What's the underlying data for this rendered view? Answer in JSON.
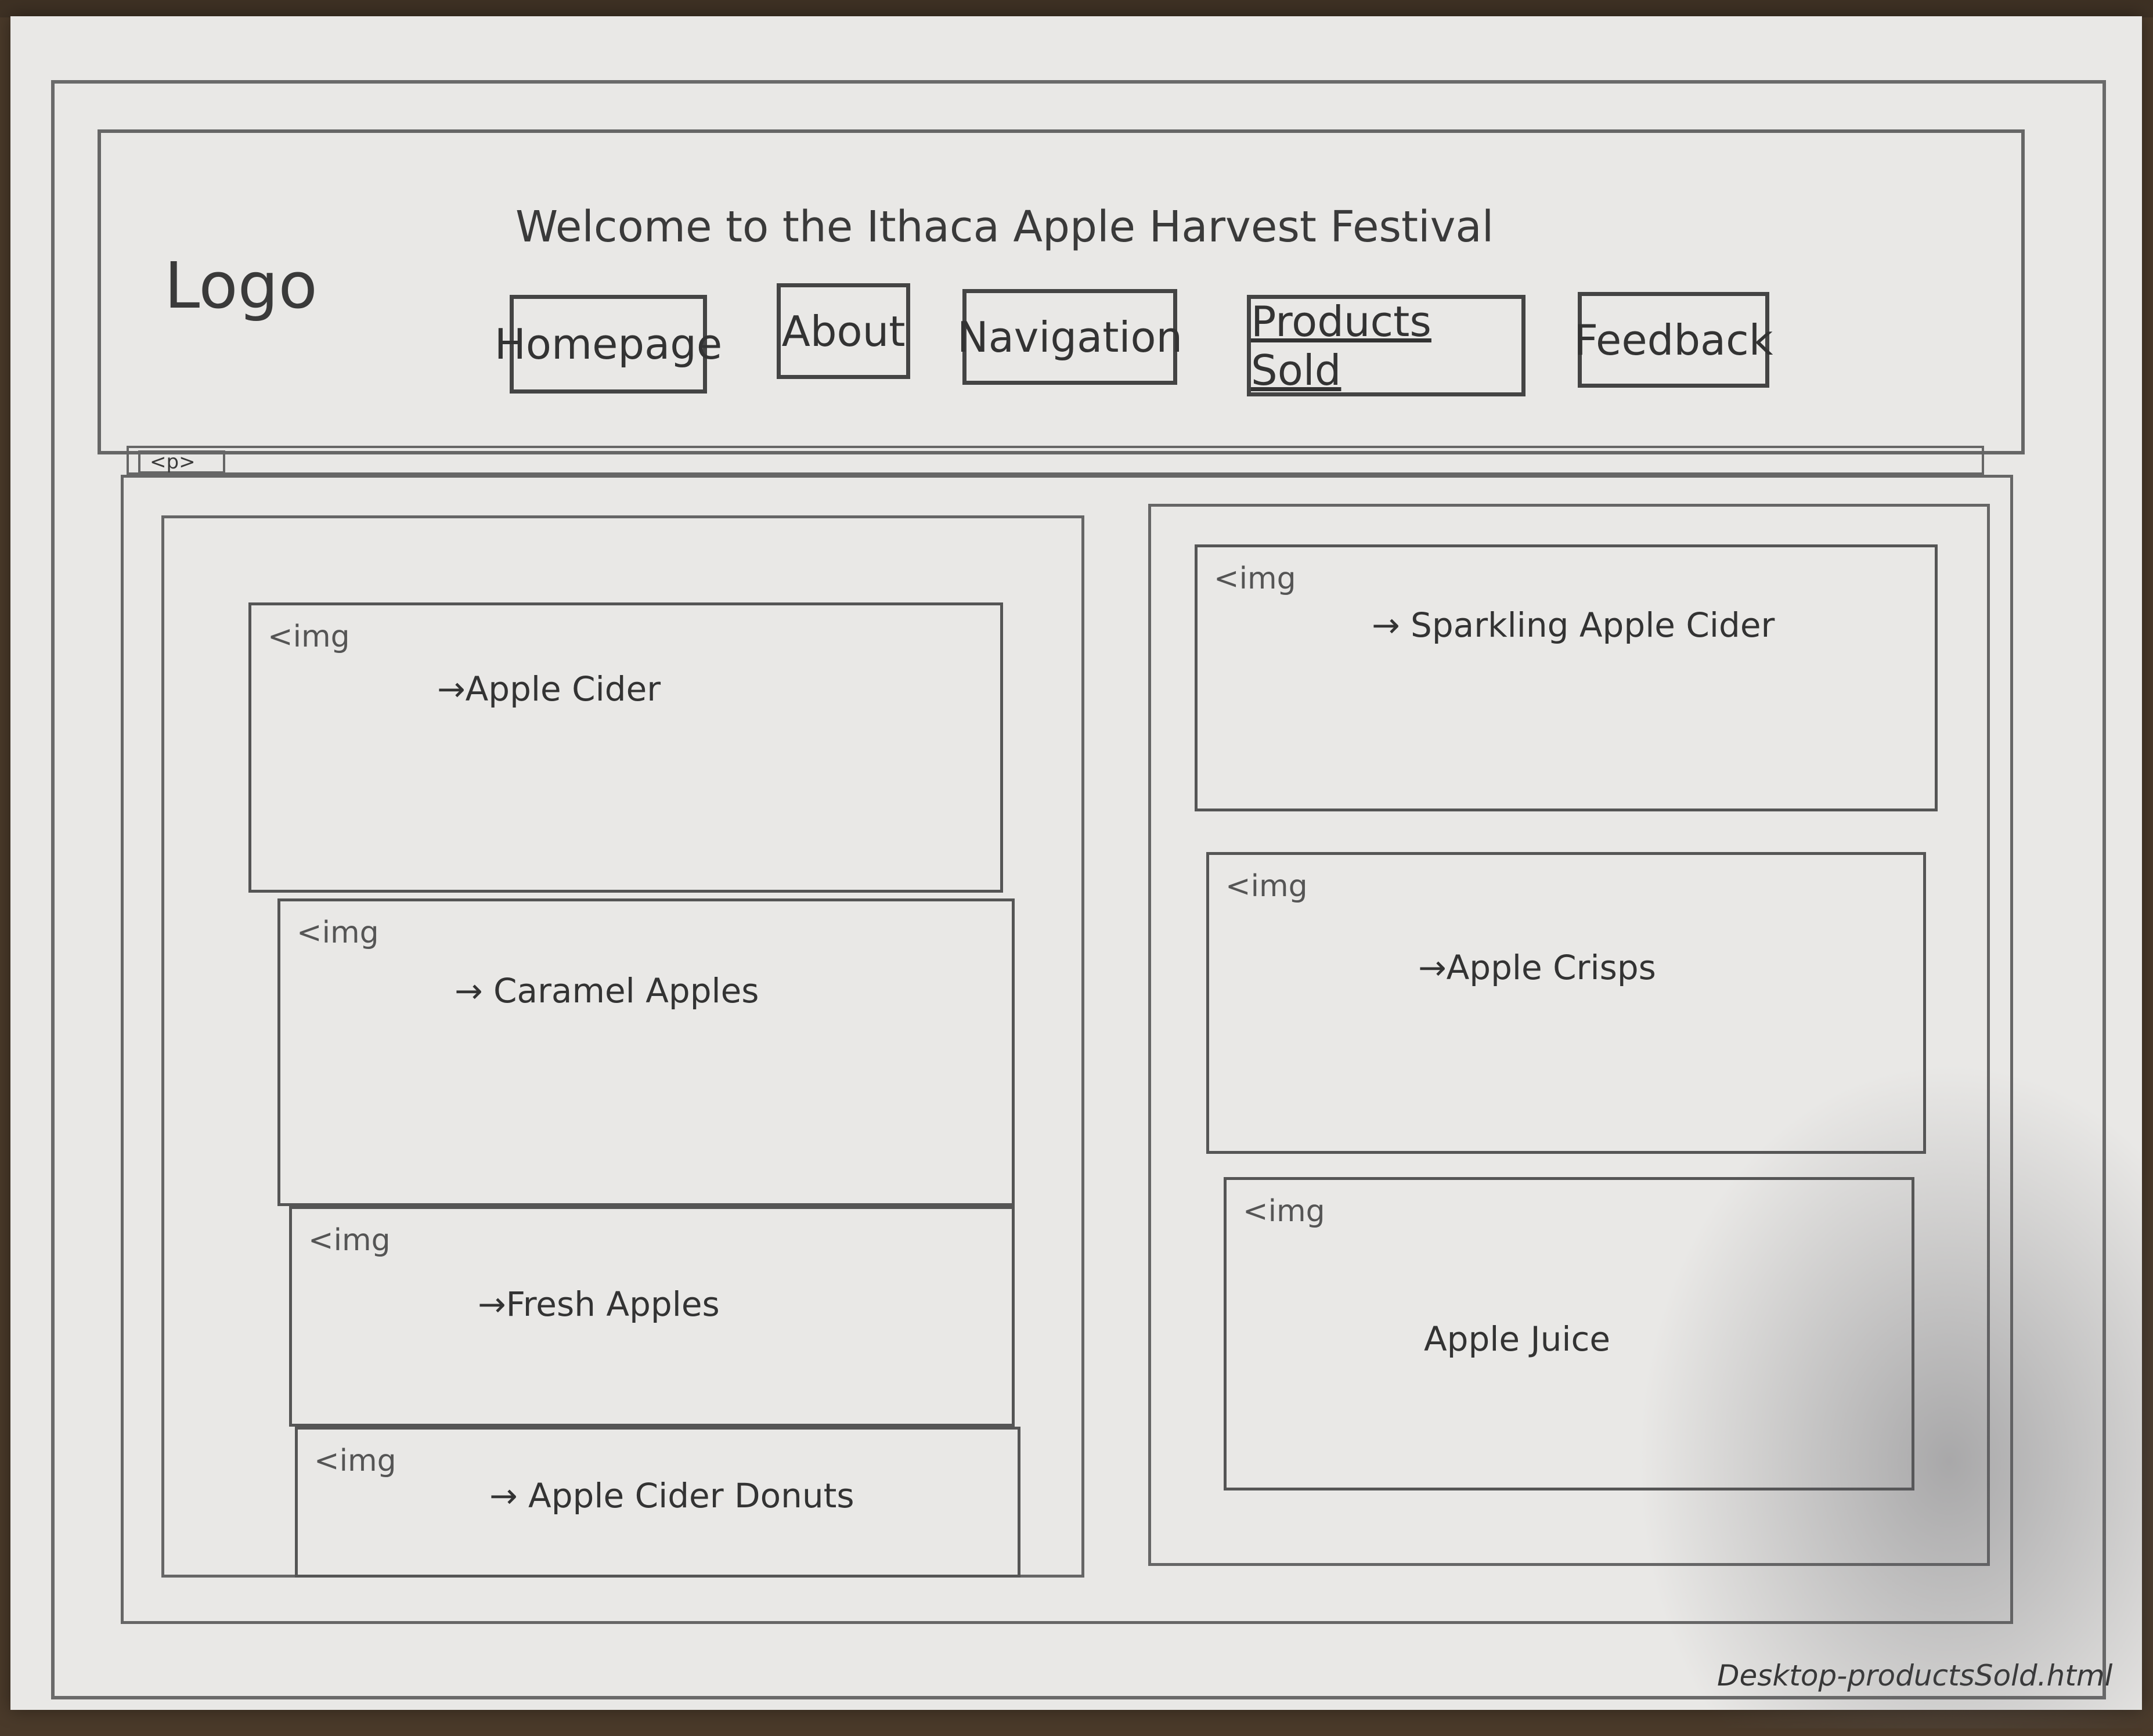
{
  "header": {
    "logo": "Logo",
    "title": "Welcome to the Ithaca Apple Harvest Festival"
  },
  "nav": {
    "items": [
      {
        "label": "Homepage"
      },
      {
        "label": "About"
      },
      {
        "label": "Navigation"
      },
      {
        "label": "Products Sold"
      },
      {
        "label": "Feedback"
      }
    ]
  },
  "paragraph_tag": "<p>",
  "products": {
    "left": [
      {
        "img_tag": "<img",
        "label": "→Apple Cider"
      },
      {
        "img_tag": "<img",
        "label": "→ Caramel Apples"
      },
      {
        "img_tag": "<img",
        "label": "→Fresh Apples"
      },
      {
        "img_tag": "<img",
        "label": "→ Apple Cider Donuts"
      }
    ],
    "right": [
      {
        "img_tag": "<img",
        "label": "→ Sparkling Apple Cider"
      },
      {
        "img_tag": "<img",
        "label": "→Apple Crisps"
      },
      {
        "img_tag": "<img",
        "label": "Apple Juice"
      }
    ]
  },
  "footer": {
    "filename": "Desktop-productsSold.html"
  }
}
